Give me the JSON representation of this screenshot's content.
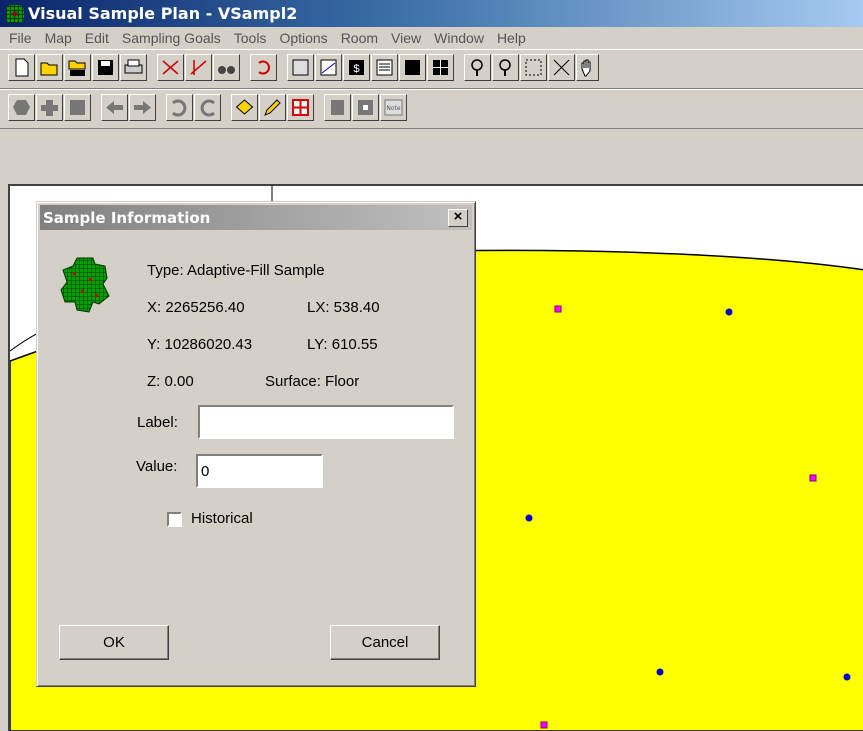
{
  "window": {
    "title": "Visual Sample Plan - VSampl2",
    "icon": "grid-map-icon"
  },
  "menu": [
    "File",
    "Map",
    "Edit",
    "Sampling Goals",
    "Tools",
    "Options",
    "Room",
    "View",
    "Window",
    "Help"
  ],
  "toolbar1_icons": [
    "new-file-icon",
    "open-folder-icon",
    "open-map-icon",
    "save-icon",
    "print-icon",
    "add-line-icon",
    "delete-line-icon",
    "binoculars-icon",
    "undo-icon",
    "map-view-icon",
    "graph-view-icon",
    "cost-icon",
    "report-icon",
    "coordinates-icon",
    "split-view-icon",
    "zoom-in-icon",
    "zoom-out-icon",
    "zoom-fit-icon",
    "zoom-extents-icon",
    "pan-icon"
  ],
  "toolbar2_icons": [
    "polygon-icon",
    "floor-icon",
    "wall-icon",
    "move-left-icon",
    "move-right-icon",
    "rotate-left-icon",
    "rotate-right-icon",
    "layers-icon",
    "pencil-icon",
    "move-center-icon",
    "page-icon",
    "box-icon",
    "note-icon"
  ],
  "toolbar2_note_label": "Note",
  "colors": {
    "map_fill": "#ffff00",
    "sample_pink": "#ff00ff",
    "sample_blue": "#0000cc",
    "title_active": "#0a246a"
  },
  "dialog": {
    "title": "Sample Information",
    "close_label": "×",
    "type_text": "Type: Adaptive-Fill Sample",
    "x_text": "X: 2265256.40",
    "lx_text": "LX: 538.40",
    "y_text": "Y: 10286020.43",
    "ly_text": "LY: 610.55",
    "z_text": "Z: 0.00",
    "surface_text": "Surface: Floor",
    "label_caption": "Label:",
    "label_value": "",
    "value_caption": "Value:",
    "value_value": "0",
    "historical_label": "Historical",
    "historical_checked": false,
    "ok_label": "OK",
    "cancel_label": "Cancel"
  }
}
